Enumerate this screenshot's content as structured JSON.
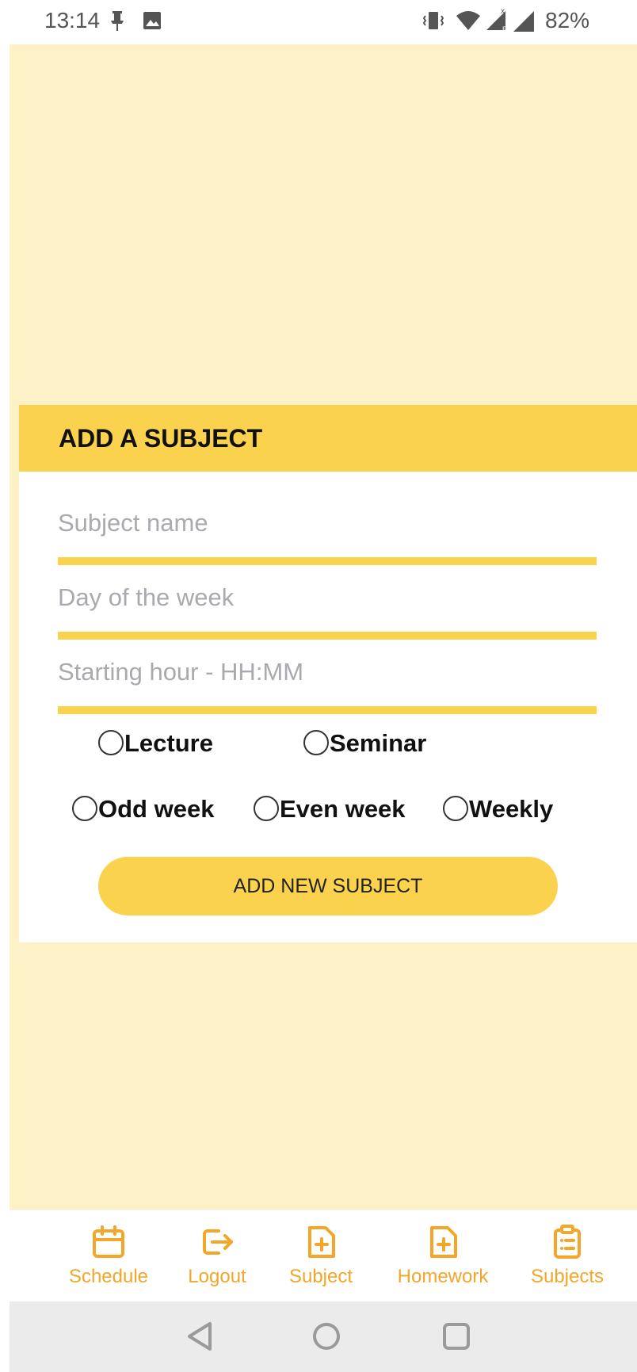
{
  "status_bar": {
    "time": "13:14",
    "battery": "82%"
  },
  "card": {
    "title": "ADD A SUBJECT",
    "fields": [
      {
        "placeholder": "Subject name",
        "value": ""
      },
      {
        "placeholder": "Day of the week",
        "value": ""
      },
      {
        "placeholder": "Starting hour - HH:MM",
        "value": ""
      }
    ],
    "type_options": [
      "Lecture",
      "Seminar"
    ],
    "frequency_options": [
      "Odd week",
      "Even week",
      "Weekly"
    ],
    "submit_label": "ADD NEW SUBJECT"
  },
  "bottom_nav": {
    "items": [
      {
        "label": "Schedule",
        "icon": "calendar-icon"
      },
      {
        "label": "Logout",
        "icon": "logout-icon"
      },
      {
        "label": "Subject",
        "icon": "file-plus-icon"
      },
      {
        "label": "Homework",
        "icon": "file-plus-icon"
      },
      {
        "label": "Subjects",
        "icon": "clipboard-list-icon"
      }
    ]
  },
  "colors": {
    "accent": "#fbd24e",
    "background": "#fdf1c7",
    "nav_icon": "#f3a627"
  }
}
